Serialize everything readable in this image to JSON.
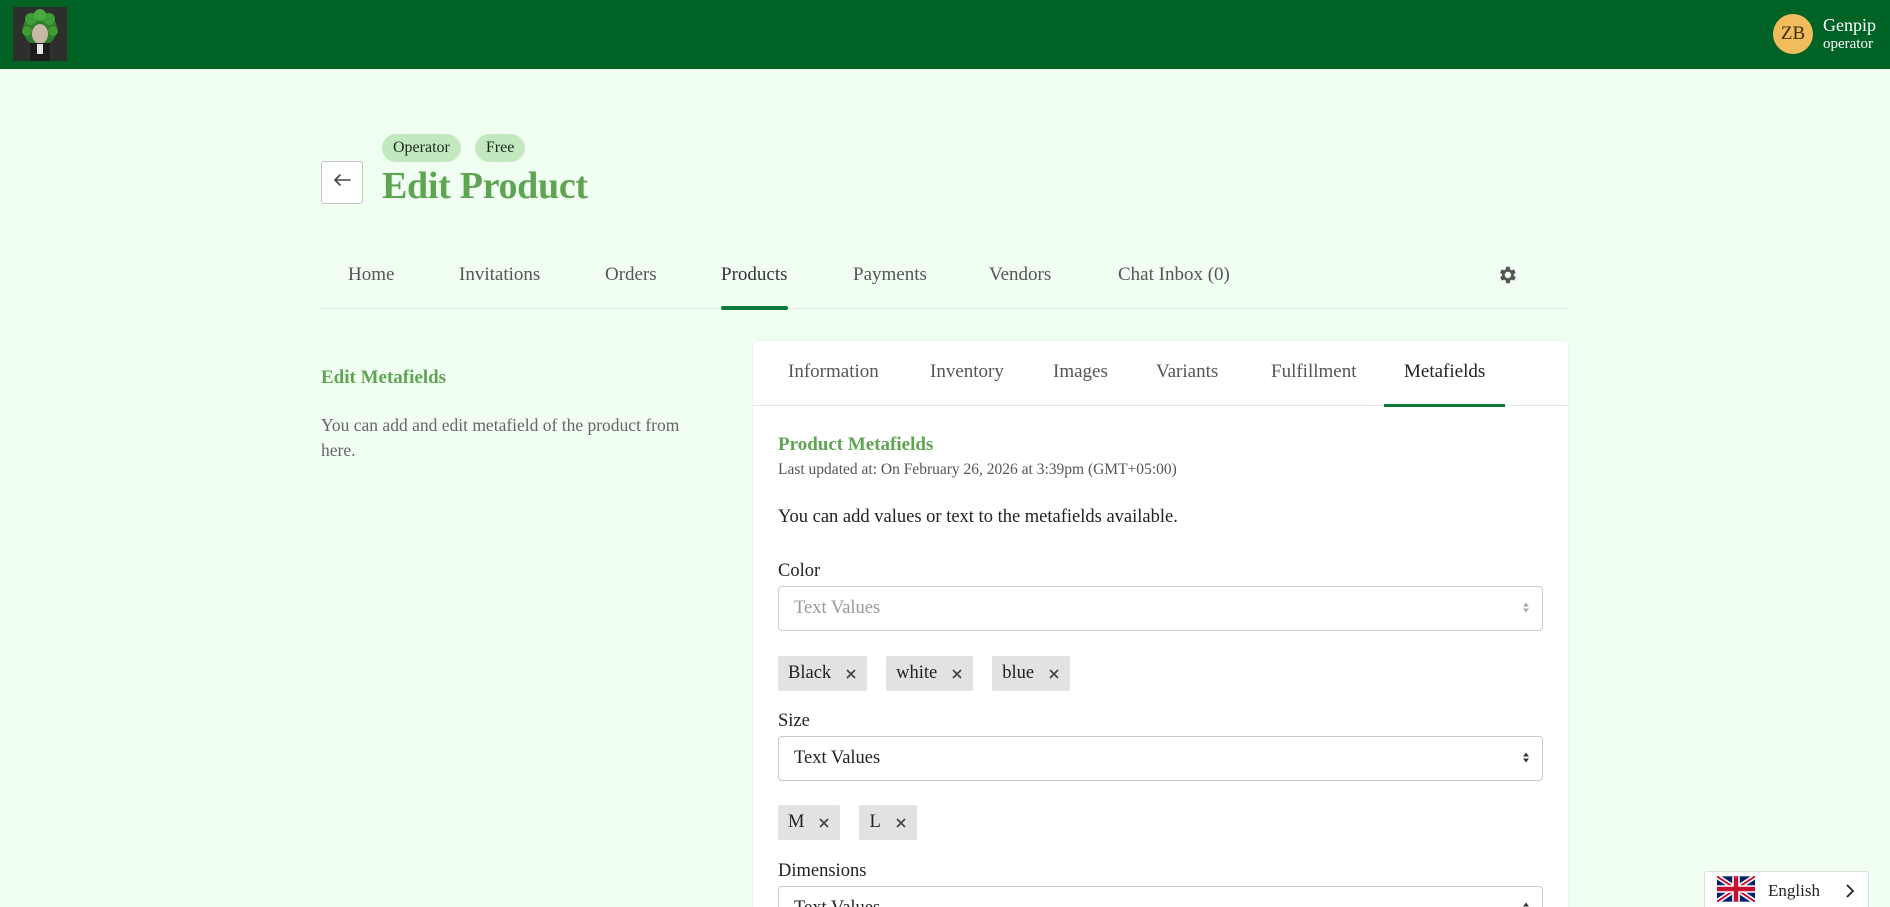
{
  "header": {
    "user": {
      "initials": "ZB",
      "name": "Genpip",
      "role": "operator"
    }
  },
  "page": {
    "badges": [
      "Operator",
      "Free"
    ],
    "title": "Edit Product"
  },
  "main_nav": {
    "items": [
      {
        "label": "Home"
      },
      {
        "label": "Invitations"
      },
      {
        "label": "Orders"
      },
      {
        "label": "Products",
        "active": true
      },
      {
        "label": "Payments"
      },
      {
        "label": "Vendors"
      },
      {
        "label": "Chat Inbox (0)"
      }
    ]
  },
  "sidebar": {
    "title": "Edit Metafields",
    "description": "You can add and edit metafield of the product from here."
  },
  "card": {
    "tabs": [
      {
        "label": "Information"
      },
      {
        "label": "Inventory"
      },
      {
        "label": "Images"
      },
      {
        "label": "Variants"
      },
      {
        "label": "Fulfillment"
      },
      {
        "label": "Metafields",
        "active": true
      }
    ],
    "section_title": "Product Metafields",
    "last_updated": "Last updated at: On February 26, 2026 at 3:39pm (GMT+05:00)",
    "intro": "You can add values or text to the metafields available.",
    "fields": [
      {
        "label": "Color",
        "select_placeholder": "Text Values",
        "tags": [
          "Black",
          "white",
          "blue"
        ]
      },
      {
        "label": "Size",
        "select_value": "Text Values",
        "tags": [
          "M",
          "L"
        ]
      },
      {
        "label": "Dimensions",
        "select_value": "Text Values"
      }
    ]
  },
  "language": {
    "label": "English"
  },
  "colors": {
    "topbar": "#006325",
    "background": "#f1fff2",
    "accent_green": "#5ea552",
    "active_underline": "#0b7a3a",
    "avatar": "#f2bb5c",
    "badge": "#c1e8bf"
  }
}
